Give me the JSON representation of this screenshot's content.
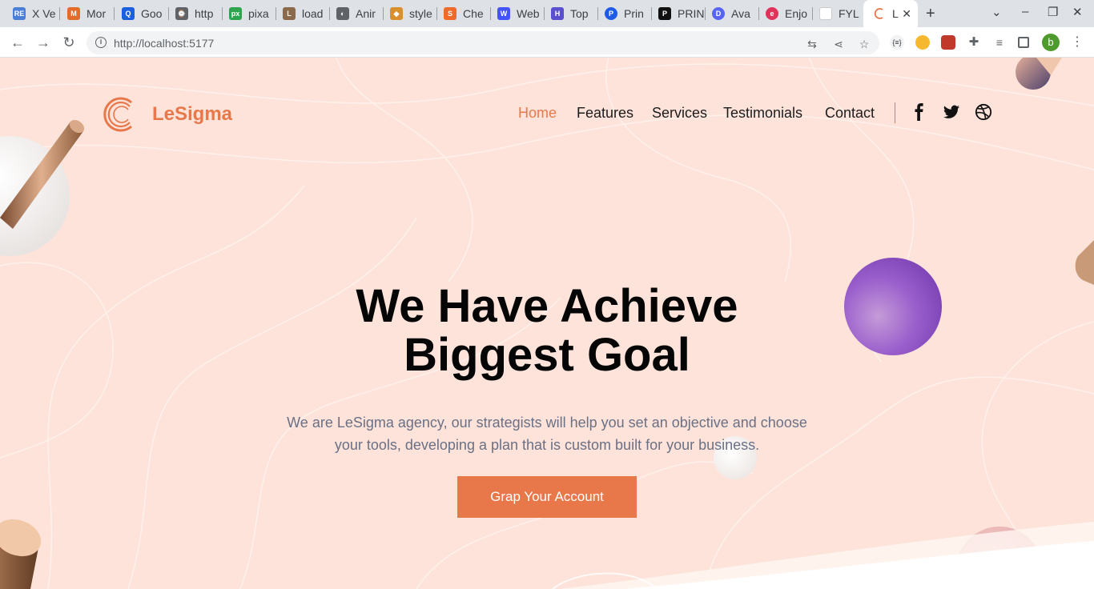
{
  "browser": {
    "tabs": [
      {
        "label": "X Ve",
        "fav_color": "#4a7fd8",
        "fav_text": "RE"
      },
      {
        "label": "Mor",
        "fav_color": "#e36c2b",
        "fav_text": "M"
      },
      {
        "label": "Goo",
        "fav_color": "#1a5fe0",
        "fav_text": "Q"
      },
      {
        "label": "http",
        "fav_color": "#5f6368",
        "fav_text": "⌚"
      },
      {
        "label": "pixa",
        "fav_color": "#2ea44f",
        "fav_text": "px"
      },
      {
        "label": "load",
        "fav_color": "#8a6a4a",
        "fav_text": "L"
      },
      {
        "label": "Anir",
        "fav_color": "#5f6368",
        "fav_text": "◐"
      },
      {
        "label": "style",
        "fav_color": "#d98f2b",
        "fav_text": "◆"
      },
      {
        "label": "Che",
        "fav_color": "#f06a2a",
        "fav_text": "S"
      },
      {
        "label": "Web",
        "fav_color": "#4353ff",
        "fav_text": "W"
      },
      {
        "label": "Top",
        "fav_color": "#5a4fcf",
        "fav_text": "H"
      },
      {
        "label": "Prin",
        "fav_color": "#1e5be6",
        "fav_text": "P"
      },
      {
        "label": "PRIN",
        "fav_color": "#111111",
        "fav_text": "P"
      },
      {
        "label": "Ava",
        "fav_color": "#5865f2",
        "fav_text": "D"
      },
      {
        "label": "Enjo",
        "fav_color": "#e0335a",
        "fav_text": "e"
      },
      {
        "label": "FYL",
        "fav_color": "#ffffff",
        "fav_text": ""
      },
      {
        "label": "L",
        "fav_color": "#e8784a",
        "fav_text": "",
        "active": true
      }
    ],
    "url": "http://localhost:5177",
    "avatar_letter": "b"
  },
  "site": {
    "brand": "LeSigma",
    "brand_color": "#e8784a",
    "nav": [
      "Home",
      "Features",
      "Services",
      "Testimonials",
      "Contact"
    ],
    "social_icons": [
      "facebook-icon",
      "twitter-icon",
      "dribbble-icon"
    ],
    "hero_title_line1": "We Have Achieve",
    "hero_title_line2": "Biggest Goal",
    "hero_subtitle_line1": "We are LeSigma agency, our strategists will help you set an objective and choose",
    "hero_subtitle_line2": "your tools, developing a plan that is custom built for your business.",
    "cta_label": "Grap Your Account",
    "background_color": "#fde3da"
  }
}
